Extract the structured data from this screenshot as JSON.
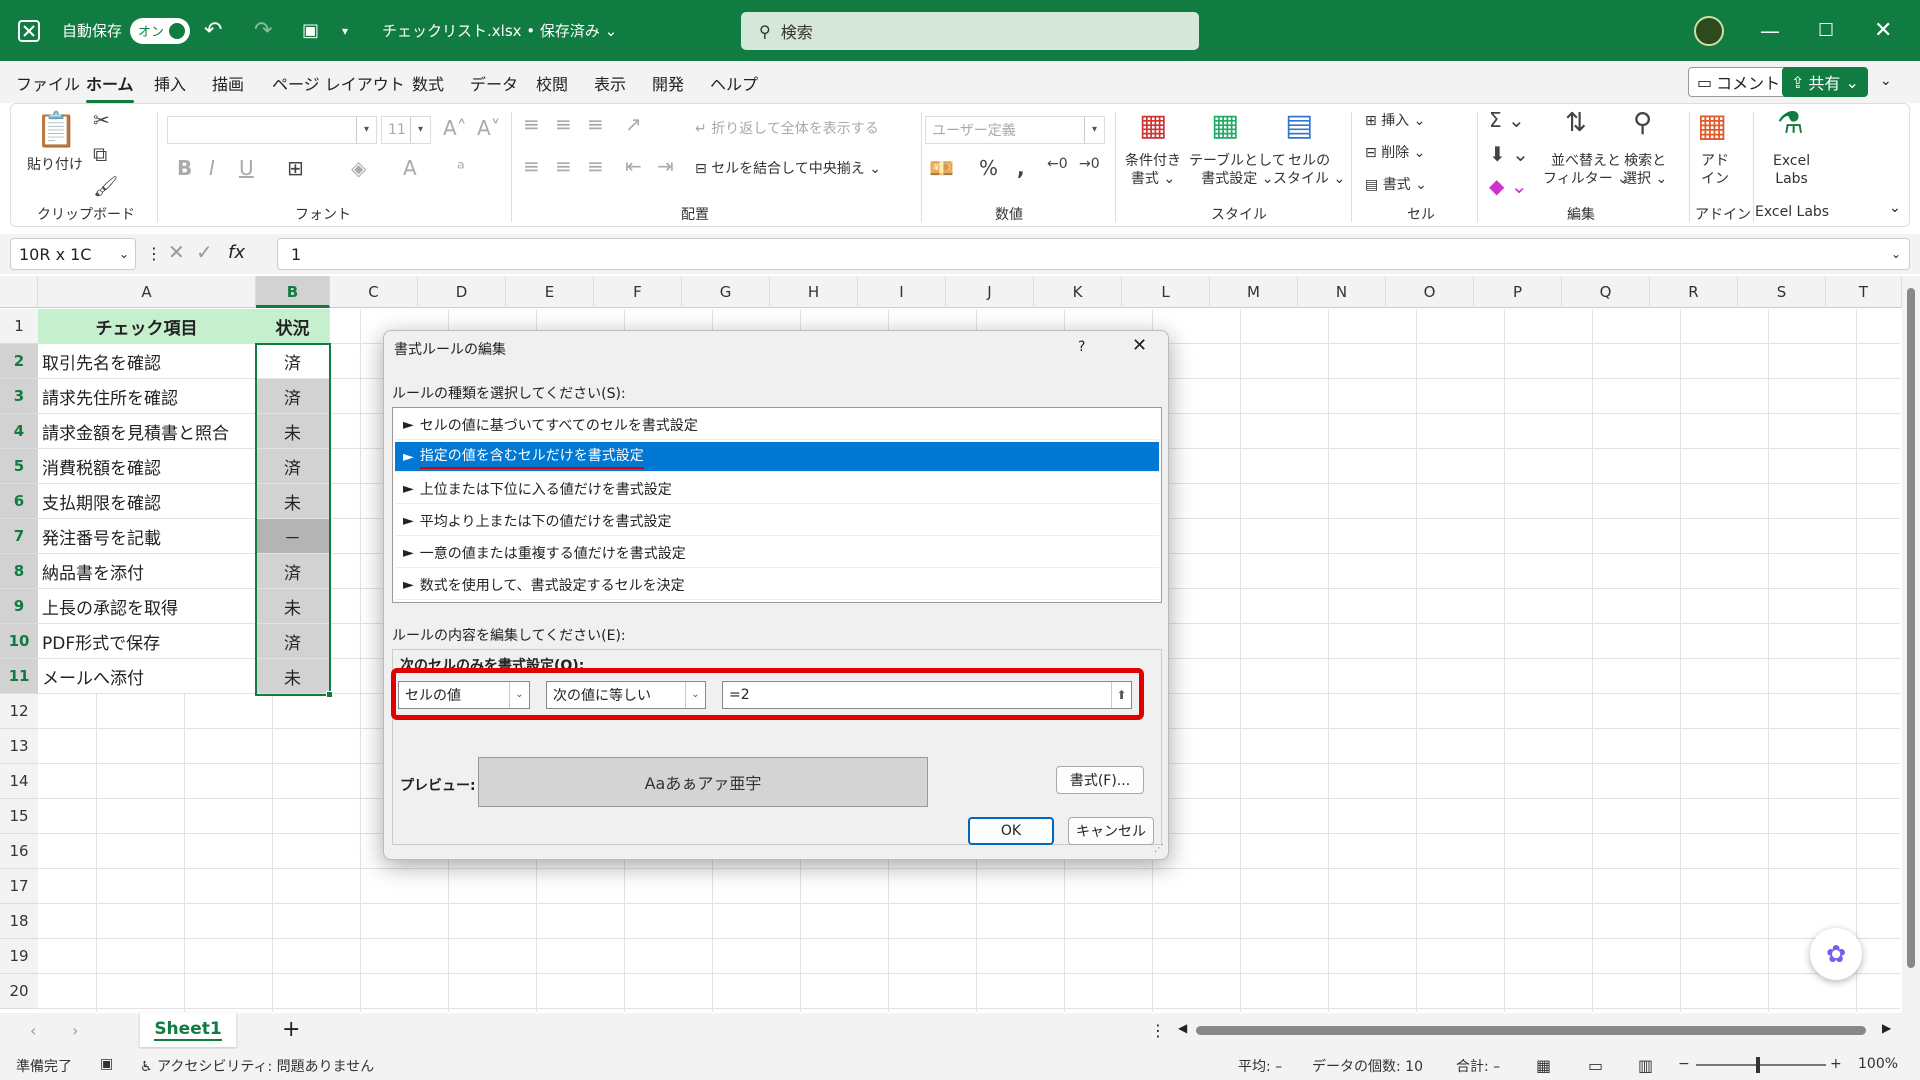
{
  "titlebar": {
    "autosave_label": "自動保存",
    "autosave_state": "オン",
    "filename": "チェックリスト.xlsx • 保存済み",
    "search_placeholder": "検索"
  },
  "menu": {
    "tabs": [
      "ファイル",
      "ホーム",
      "挿入",
      "描画",
      "ページ レイアウト",
      "数式",
      "データ",
      "校閲",
      "表示",
      "開発",
      "ヘルプ"
    ],
    "active": "ホーム",
    "comment": "コメント",
    "share": "共有"
  },
  "ribbon": {
    "clipboard": {
      "paste": "貼り付け",
      "group": "クリップボード"
    },
    "font": {
      "size": "11",
      "group": "フォント"
    },
    "alignment": {
      "wrap": "折り返して全体を表示する",
      "merge": "セルを結合して中央揃え",
      "group": "配置"
    },
    "number": {
      "format": "ユーザー定義",
      "group": "数値"
    },
    "styles": {
      "cond_line1": "条件付き",
      "cond_line2": "書式",
      "table_line1": "テーブルとして",
      "table_line2": "書式設定",
      "cell_line1": "セルの",
      "cell_line2": "スタイル",
      "group": "スタイル"
    },
    "cells": {
      "insert": "挿入",
      "delete": "削除",
      "format": "書式",
      "group": "セル"
    },
    "editing": {
      "sort_line1": "並べ替えと",
      "sort_line2": "フィルター",
      "find_line1": "検索と",
      "find_line2": "選択",
      "group": "編集"
    },
    "addins": {
      "line1": "アド",
      "line2": "イン",
      "group": "アドイン"
    },
    "labs": {
      "line1": "Excel",
      "line2": "Labs",
      "group": "Excel Labs"
    }
  },
  "formula": {
    "namebox": "10R x 1C",
    "value": "1"
  },
  "columns": [
    "A",
    "B",
    "C",
    "D",
    "E",
    "F",
    "G",
    "H",
    "I",
    "J",
    "K",
    "L",
    "M",
    "N",
    "O",
    "P",
    "Q",
    "R",
    "S",
    "T"
  ],
  "rows": [
    "1",
    "2",
    "3",
    "4",
    "5",
    "6",
    "7",
    "8",
    "9",
    "10",
    "11",
    "12",
    "13",
    "14",
    "15",
    "16",
    "17",
    "18",
    "19",
    "20"
  ],
  "table": {
    "header_a": "チェック項目",
    "header_b": "状況",
    "items": [
      {
        "item": "取引先名を確認",
        "status": "済"
      },
      {
        "item": "請求先住所を確認",
        "status": "済"
      },
      {
        "item": "請求金額を見積書と照合",
        "status": "未"
      },
      {
        "item": "消費税額を確認",
        "status": "済"
      },
      {
        "item": "支払期限を確認",
        "status": "未"
      },
      {
        "item": "発注番号を記載",
        "status": "－"
      },
      {
        "item": "納品書を添付",
        "status": "済"
      },
      {
        "item": "上長の承認を取得",
        "status": "未"
      },
      {
        "item": "PDF形式で保存",
        "status": "済"
      },
      {
        "item": "メールへ添付",
        "status": "未"
      }
    ]
  },
  "dialog": {
    "title": "書式ルールの編集",
    "help": "?",
    "rule_type_label": "ルールの種類を選択してください(S):",
    "rules": [
      "セルの値に基づいてすべてのセルを書式設定",
      "指定の値を含むセルだけを書式設定",
      "上位または下位に入る値だけを書式設定",
      "平均より上または下の値だけを書式設定",
      "一意の値または重複する値だけを書式設定",
      "数式を使用して、書式設定するセルを決定"
    ],
    "selected_rule_index": 1,
    "edit_label": "ルールの内容を編集してください(E):",
    "condition_heading": "次のセルのみを書式設定(O):",
    "combo1": "セルの値",
    "combo2": "次の値に等しい",
    "value": "=2",
    "preview_label": "プレビュー:",
    "preview_text": "Aaあぁアァ亜宇",
    "format_button": "書式(F)...",
    "ok": "OK",
    "cancel": "キャンセル"
  },
  "sheets": {
    "active": "Sheet1"
  },
  "status": {
    "ready": "準備完了",
    "accessibility": "アクセシビリティ: 問題ありません",
    "average": "平均: –",
    "count": "データの個数: 10",
    "sum": "合計: –",
    "zoom": "100%"
  },
  "colors": {
    "excel_green": "#107c41",
    "header_fill": "#c6efce",
    "highlight": "#e00000",
    "selection": "#0078d4"
  }
}
